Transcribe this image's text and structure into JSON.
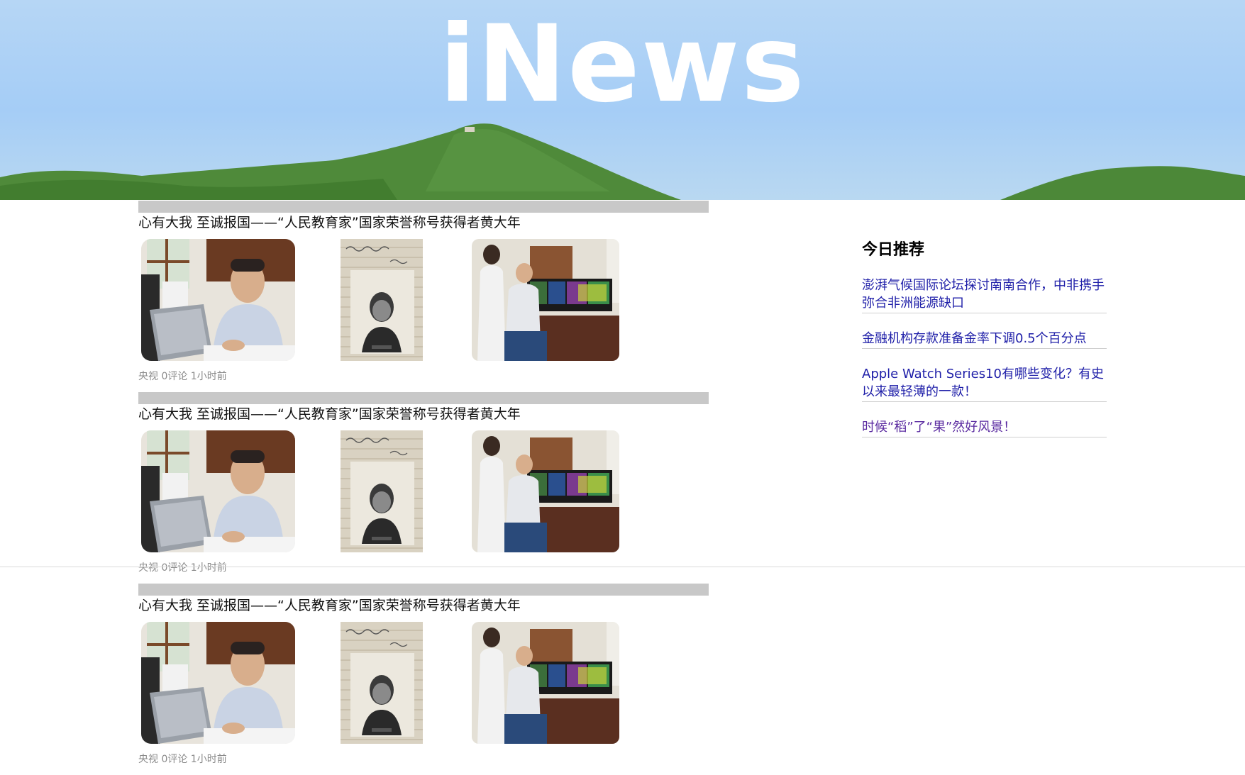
{
  "brand": {
    "title": "iNews"
  },
  "feed": {
    "articles": [
      {
        "title": "心有大我 至诚报国——“人民教育家”国家荣誉称号获得者黄大年",
        "meta": "央视 0评论 1小时前",
        "images": [
          "teacher-at-desk-photo",
          "old-notebook-portrait-photo",
          "lab-monitors-photo"
        ]
      },
      {
        "title": "心有大我 至诚报国——“人民教育家”国家荣誉称号获得者黄大年",
        "meta": "央视 0评论 1小时前",
        "images": [
          "teacher-at-desk-photo",
          "old-notebook-portrait-photo",
          "lab-monitors-photo"
        ]
      },
      {
        "title": "心有大我 至诚报国——“人民教育家”国家荣誉称号获得者黄大年",
        "meta": "央视 0评论 1小时前",
        "images": [
          "teacher-at-desk-photo",
          "old-notebook-portrait-photo",
          "lab-monitors-photo"
        ]
      }
    ]
  },
  "sidebar": {
    "heading": "今日推荐",
    "links": [
      {
        "text": "澎湃气候国际论坛探讨南南合作，中非携手弥合非洲能源缺口",
        "color": "#1e1ea8"
      },
      {
        "text": "金融机构存款准备金率下调0.5个百分点",
        "color": "#1e1ea8"
      },
      {
        "text": "Apple Watch Series10有哪些变化？有史以来最轻薄的一款！",
        "color": "#1e1ea8"
      },
      {
        "text": "时候“稻”了“果”然好风景！",
        "color": "#5a2aa0"
      }
    ]
  },
  "colors": {
    "sky": "#a5cdf6",
    "separator_bar": "#c8c8c8",
    "link": "#1e1ea8",
    "visited_link": "#5a2aa0",
    "meta_text": "#8a8a8a"
  }
}
